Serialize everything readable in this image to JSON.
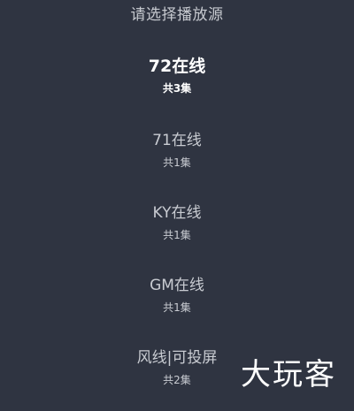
{
  "title": "请选择播放源",
  "sources": [
    {
      "name": "72在线",
      "count": "共3集",
      "selected": true
    },
    {
      "name": "71在线",
      "count": "共1集",
      "selected": false
    },
    {
      "name": "KY在线",
      "count": "共1集",
      "selected": false
    },
    {
      "name": "GM在线",
      "count": "共1集",
      "selected": false
    },
    {
      "name": "风线|可投屏",
      "count": "共2集",
      "selected": false
    }
  ],
  "watermark": "大玩客",
  "colors": {
    "background": "#2f3441",
    "text": "#c9ccd2",
    "selected_text": "#ffffff"
  }
}
